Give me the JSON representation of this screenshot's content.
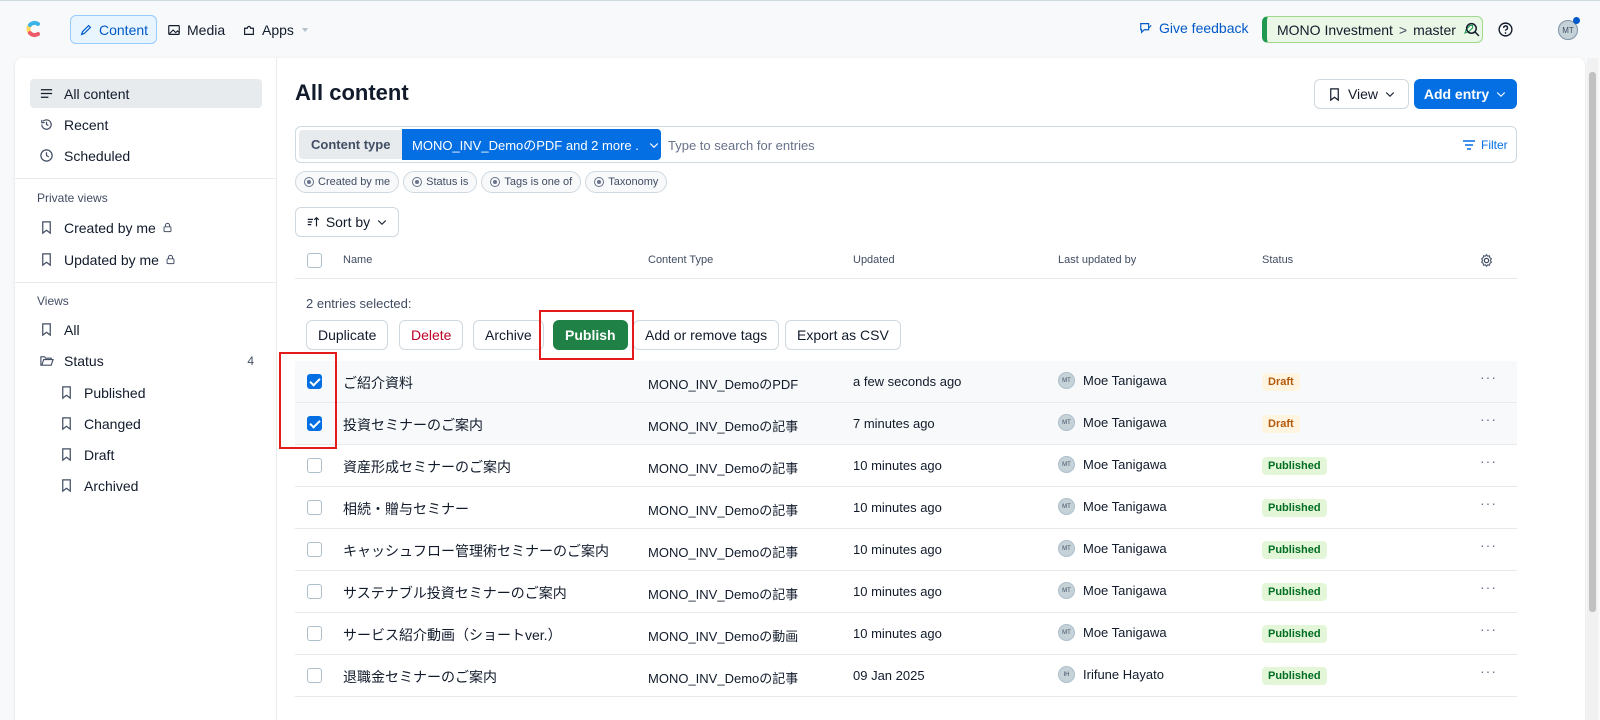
{
  "topbar": {
    "nav": [
      {
        "label": "Content",
        "icon": "pencil-icon",
        "active": true
      },
      {
        "label": "Media",
        "icon": "image-icon",
        "active": false
      },
      {
        "label": "Apps",
        "icon": "puzzle-icon",
        "active": false
      }
    ],
    "feedback": "Give feedback",
    "space": "MONO Investment",
    "environment": "master",
    "avatar_initials": "MT"
  },
  "sidebar": {
    "main_items": [
      {
        "label": "All content",
        "icon": "list-icon",
        "active": true
      },
      {
        "label": "Recent",
        "icon": "history-icon"
      },
      {
        "label": "Scheduled",
        "icon": "clock-icon"
      }
    ],
    "private_heading": "Private views",
    "private_items": [
      {
        "label": "Created by me",
        "icon": "bookmark-icon",
        "locked": true
      },
      {
        "label": "Updated by me",
        "icon": "bookmark-icon",
        "locked": true
      }
    ],
    "views_heading": "Views",
    "views_all": "All",
    "status_folder": {
      "label": "Status",
      "count": "4"
    },
    "status_items": [
      {
        "label": "Published"
      },
      {
        "label": "Changed"
      },
      {
        "label": "Draft"
      },
      {
        "label": "Archived"
      }
    ]
  },
  "main": {
    "title": "All content",
    "view_button": "View",
    "add_entry_button": "Add entry",
    "content_type_label": "Content type",
    "content_type_value": "MONO_INV_DemoのPDF and 2 more ...",
    "search_placeholder": "Type to search for entries",
    "filter_label": "Filter",
    "chips": [
      "Created by me",
      "Status is",
      "Tags is one of",
      "Taxonomy"
    ],
    "sort_label": "Sort by",
    "columns": [
      "Name",
      "Content Type",
      "Updated",
      "Last updated by",
      "Status"
    ],
    "selected_label": "2 entries selected:",
    "bulk_actions": [
      "Duplicate",
      "Delete",
      "Archive",
      "Publish",
      "Add or remove tags",
      "Export as CSV"
    ],
    "rows": [
      {
        "name": "ご紹介資料",
        "type": "MONO_INV_DemoのPDF",
        "updated": "a few seconds ago",
        "by": "Moe Tanigawa",
        "initials": "MT",
        "status": "Draft",
        "selected": true
      },
      {
        "name": "投資セミナーのご案内",
        "type": "MONO_INV_Demoの記事",
        "updated": "7 minutes ago",
        "by": "Moe Tanigawa",
        "initials": "MT",
        "status": "Draft",
        "selected": true
      },
      {
        "name": "資産形成セミナーのご案内",
        "type": "MONO_INV_Demoの記事",
        "updated": "10 minutes ago",
        "by": "Moe Tanigawa",
        "initials": "MT",
        "status": "Published",
        "selected": false
      },
      {
        "name": "相続・贈与セミナー",
        "type": "MONO_INV_Demoの記事",
        "updated": "10 minutes ago",
        "by": "Moe Tanigawa",
        "initials": "MT",
        "status": "Published",
        "selected": false
      },
      {
        "name": "キャッシュフロー管理術セミナーのご案内",
        "type": "MONO_INV_Demoの記事",
        "updated": "10 minutes ago",
        "by": "Moe Tanigawa",
        "initials": "MT",
        "status": "Published",
        "selected": false
      },
      {
        "name": "サステナブル投資セミナーのご案内",
        "type": "MONO_INV_Demoの記事",
        "updated": "10 minutes ago",
        "by": "Moe Tanigawa",
        "initials": "MT",
        "status": "Published",
        "selected": false
      },
      {
        "name": "サービス紹介動画（ショートver.）",
        "type": "MONO_INV_Demoの動画",
        "updated": "10 minutes ago",
        "by": "Moe Tanigawa",
        "initials": "MT",
        "status": "Published",
        "selected": false
      },
      {
        "name": "退職金セミナーのご案内",
        "type": "MONO_INV_Demoの記事",
        "updated": "09 Jan 2025",
        "by": "Irifune Hayato",
        "initials": "IH",
        "status": "Published",
        "selected": false
      }
    ]
  },
  "colors": {
    "accent": "#036fe3",
    "publish": "#1f8145",
    "highlight": "#e31b1b",
    "draft_badge": "#fff4e0",
    "published_badge": "#e3f7d8"
  }
}
